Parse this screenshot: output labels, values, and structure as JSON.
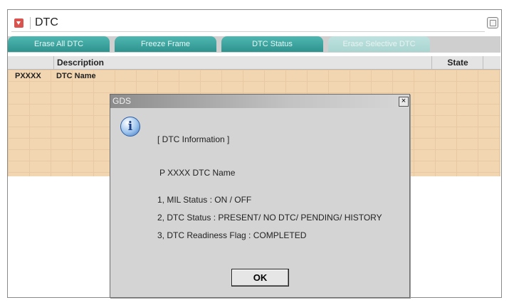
{
  "header": {
    "title": "DTC",
    "icon": "dropdown-arrow-icon"
  },
  "tabs": [
    {
      "label": "Erase All DTC",
      "enabled": true
    },
    {
      "label": "Freeze Frame",
      "enabled": true
    },
    {
      "label": "DTC Status",
      "enabled": true
    },
    {
      "label": "Erase Selective DTC",
      "enabled": false
    }
  ],
  "table": {
    "columns": [
      "Description",
      "State"
    ],
    "rows": [
      {
        "code": "PXXXX",
        "name": "DTC Name"
      }
    ]
  },
  "dialog": {
    "title": "GDS",
    "close": "×",
    "icon": "info-icon",
    "icon_glyph": "i",
    "heading": "[ DTC Information ]",
    "dtc_line": "P XXXX DTC Name",
    "items": [
      "1, MIL Status : ON / OFF",
      "2, DTC Status : PRESENT/ NO DTC/ PENDING/ HISTORY",
      "3, DTC Readiness Flag : COMPLETED"
    ],
    "ok_label": "OK"
  },
  "colors": {
    "tab_active": "#3aa39e",
    "grid_bg": "#f2d6b1",
    "header_icon": "#d9534f"
  }
}
